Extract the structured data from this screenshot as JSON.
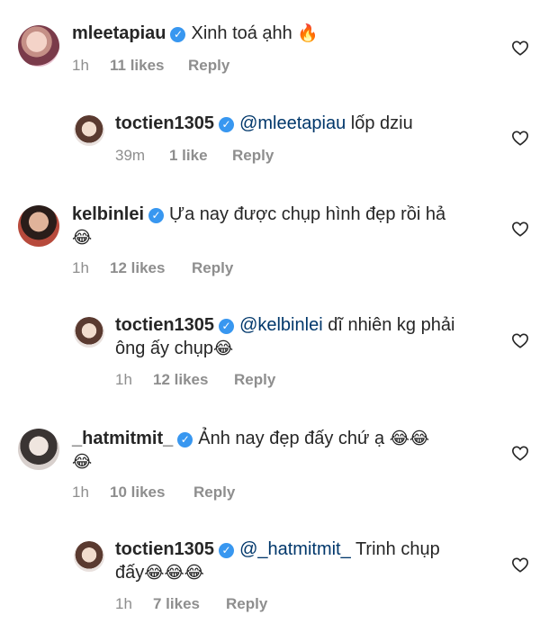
{
  "comments": [
    {
      "username": "mleetapiau",
      "text": "Xinh toá ạhh",
      "emoji": "🔥",
      "time": "1h",
      "likes": "11 likes",
      "reply": "Reply"
    },
    {
      "username": "toctien1305",
      "mention": "@mleetapiau",
      "text": "lốp dziu",
      "time": "39m",
      "likes": "1 like",
      "reply": "Reply"
    },
    {
      "username": "kelbinlei",
      "text": "Ựa nay được chụp hình đẹp rồi  hả",
      "emoji": "😂",
      "time": "1h",
      "likes": "12 likes",
      "reply": "Reply"
    },
    {
      "username": "toctien1305",
      "mention": "@kelbinlei",
      "text": "dĩ nhiên kg phải",
      "text2": "ông ấy chụp",
      "emoji": "😂",
      "time": "1h",
      "likes": "12 likes",
      "reply": "Reply"
    },
    {
      "username": "_hatmitmit_",
      "text": "Ảnh nay đẹp đấy chứ ạ",
      "emoji": "😂😂",
      "emoji2": "😂",
      "time": "1h",
      "likes": "10 likes",
      "reply": "Reply"
    },
    {
      "username": "toctien1305",
      "mention": "@_hatmitmit_",
      "text": "Trinh chụp",
      "text2": "đấy",
      "emoji": "😂😂😂",
      "time": "1h",
      "likes": "7 likes",
      "reply": "Reply"
    }
  ],
  "icons": {
    "verified": "✓",
    "heart": "heart-outline-icon"
  }
}
